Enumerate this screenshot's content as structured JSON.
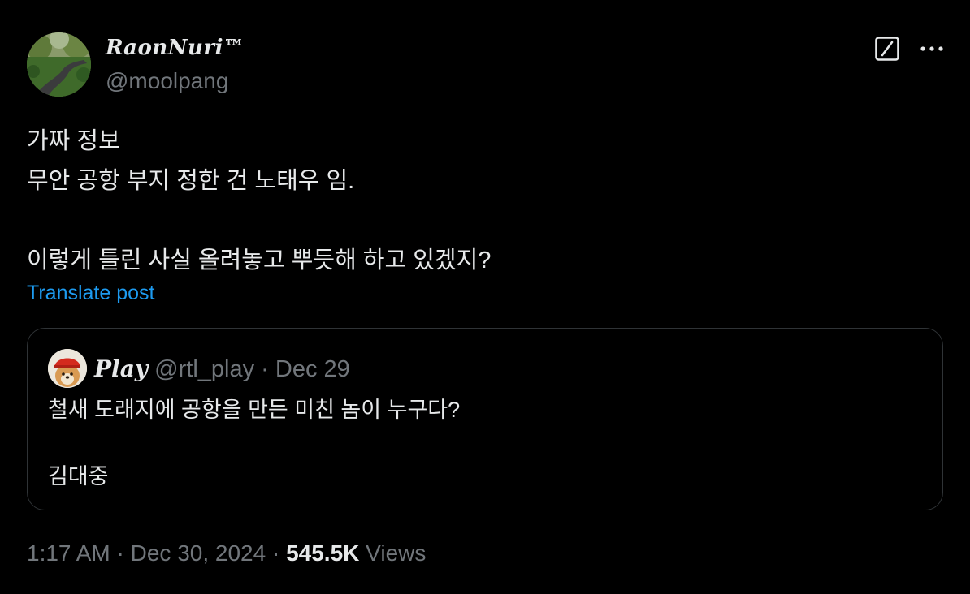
{
  "author": {
    "display_name": "𝑹𝒂𝒐𝒏𝑵𝒖𝒓𝒊™",
    "handle": "@moolpang"
  },
  "post": {
    "lines": [
      "가짜 정보",
      "무안 공항 부지 정한 건 노태우 임.",
      "",
      "이렇게 틀린 사실 올려놓고 뿌듯해 하고 있겠지?"
    ],
    "translate_label": "Translate post"
  },
  "quoted": {
    "display_name": "𝑷𝒍𝒂𝒚",
    "handle": "@rtl_play",
    "separator": "·",
    "date": "Dec 29",
    "lines": [
      "철새 도래지에 공항을 만든 미친 놈이 누구다?",
      "",
      "김대중"
    ]
  },
  "footer": {
    "time": "1:17 AM",
    "separator": "·",
    "date": "Dec 30, 2024",
    "views_count": "545.5K",
    "views_label": "Views"
  },
  "icons": {
    "grok": "grok-icon",
    "more": "more-icon"
  },
  "colors": {
    "background": "#000000",
    "text": "#e7e9ea",
    "secondary": "#71767b",
    "link": "#1d9bf0",
    "border": "#2f3336"
  }
}
